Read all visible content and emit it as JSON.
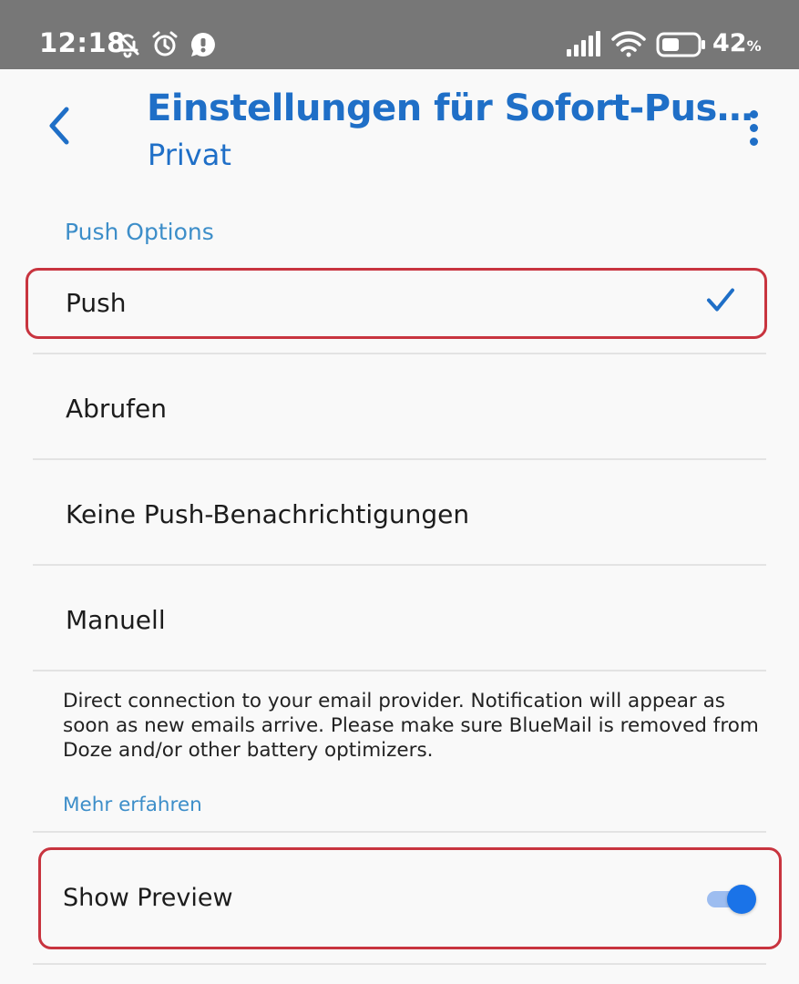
{
  "status_bar": {
    "time": "12:18",
    "battery": "42",
    "battery_unit": "%",
    "icons": [
      "bell-off-icon",
      "alarm-icon",
      "chat-icon",
      "signal-icon",
      "wifi-icon",
      "battery-icon"
    ]
  },
  "app_bar": {
    "title": "Einstellungen für Sofort-Pus…",
    "subtitle": "Privat",
    "back_icon": "chevron-left-icon",
    "menu_icon": "more-vert-icon",
    "accent_color": "#1f6fc7"
  },
  "section": {
    "header": "Push Options",
    "options": [
      {
        "label": "Push",
        "selected": true
      },
      {
        "label": "Abrufen",
        "selected": false
      },
      {
        "label": "Keine Push-Benachrichtigungen",
        "selected": false
      },
      {
        "label": "Manuell",
        "selected": false
      }
    ],
    "description": "Direct connection to your email provider. Notification will appear as soon as new emails arrive. Please make sure BlueMail is removed from Doze and/or other battery optimizers.",
    "learn_more": "Mehr erfahren"
  },
  "show_preview": {
    "label": "Show Preview",
    "enabled": true
  },
  "highlight_color": "#c8343f"
}
